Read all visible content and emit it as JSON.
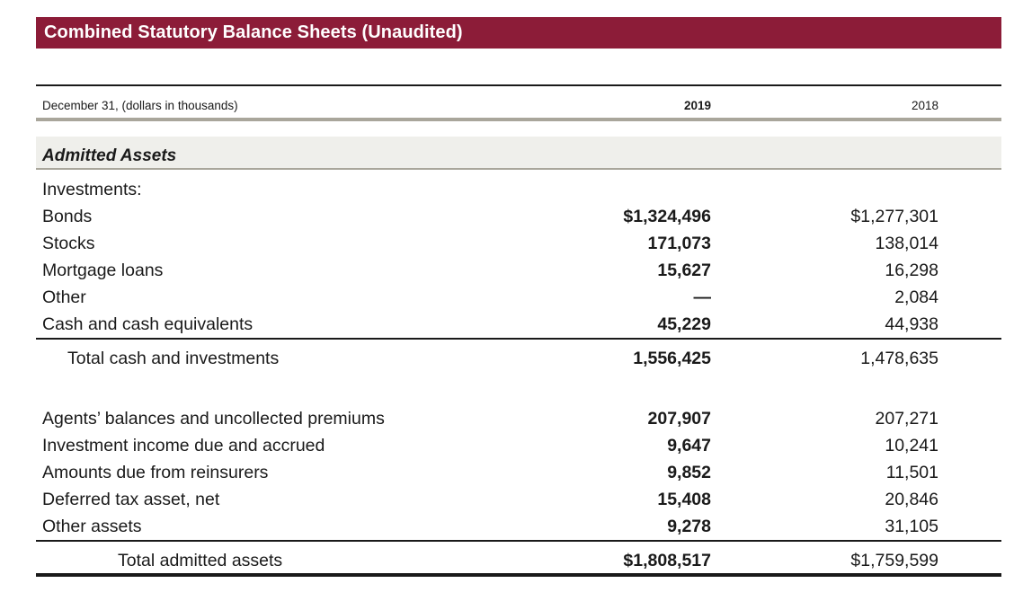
{
  "title": "Combined Statutory Balance Sheets (Unaudited)",
  "header": {
    "label": "December 31, (dollars in thousands)",
    "col2019": "2019",
    "col2018": "2018"
  },
  "section_title": "Admitted Assets",
  "rows": [
    {
      "label": "Investments:",
      "v2019": "",
      "v2018": ""
    },
    {
      "label": "Bonds",
      "v2019": "$1,324,496",
      "v2018": "$1,277,301"
    },
    {
      "label": "Stocks",
      "v2019": "171,073",
      "v2018": "138,014"
    },
    {
      "label": "Mortgage loans",
      "v2019": "15,627",
      "v2018": "16,298"
    },
    {
      "label": "Other",
      "v2019": "—",
      "v2018": "2,084"
    },
    {
      "label": "Cash and cash equivalents",
      "v2019": "45,229",
      "v2018": "44,938"
    },
    {
      "label": "Total cash and investments",
      "v2019": "1,556,425",
      "v2018": "1,478,635"
    },
    {
      "label": "Agents’ balances and uncollected premiums",
      "v2019": "207,907",
      "v2018": "207,271"
    },
    {
      "label": "Investment income due and accrued",
      "v2019": "9,647",
      "v2018": "10,241"
    },
    {
      "label": "Amounts due from reinsurers",
      "v2019": "9,852",
      "v2018": "11,501"
    },
    {
      "label": "Deferred tax asset, net",
      "v2019": "15,408",
      "v2018": "20,846"
    },
    {
      "label": "Other assets",
      "v2019": "9,278",
      "v2018": "31,105"
    },
    {
      "label": "Total admitted assets",
      "v2019": "$1,808,517",
      "v2018": "$1,759,599"
    }
  ],
  "colors": {
    "title_bar": "#8c1c38",
    "section_band": "#efefeb",
    "header_rule": "#a9a69b"
  }
}
